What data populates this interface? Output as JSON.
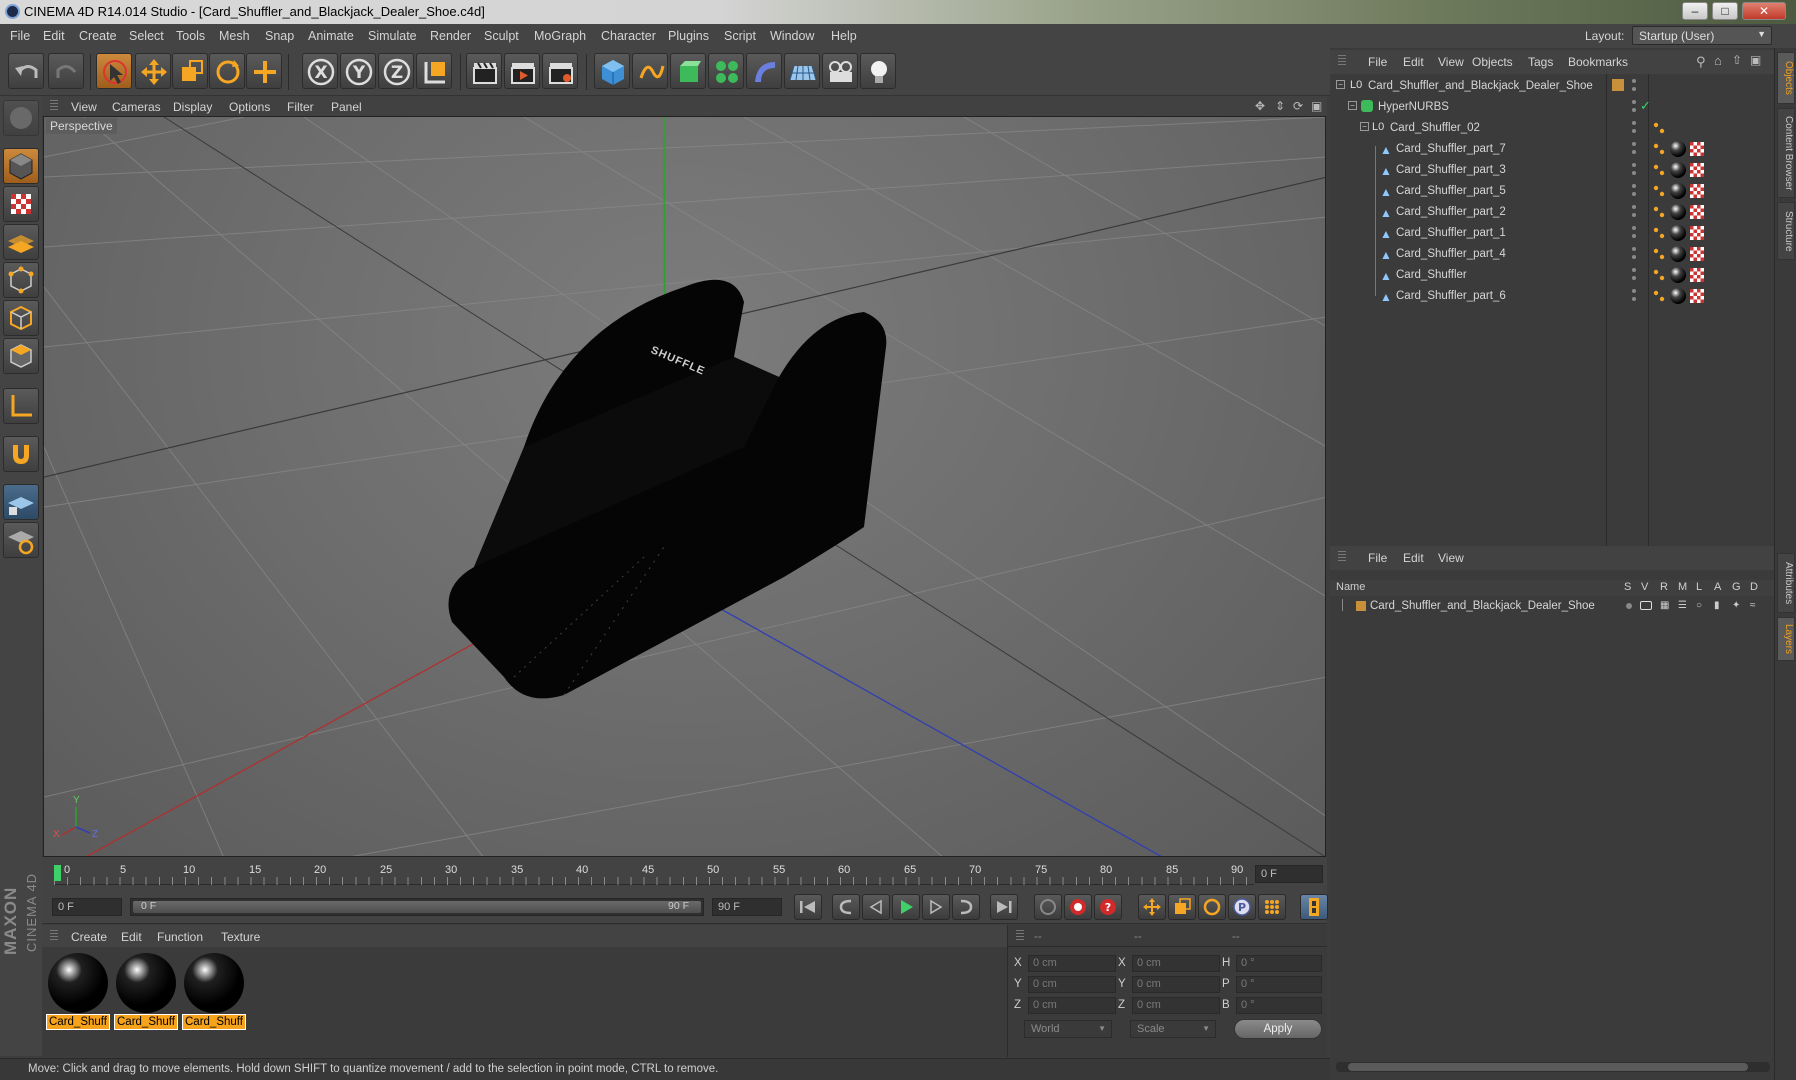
{
  "window": {
    "title": "CINEMA 4D R14.014 Studio - [Card_Shuffler_and_Blackjack_Dealer_Shoe.c4d]"
  },
  "menu": [
    "File",
    "Edit",
    "Create",
    "Select",
    "Tools",
    "Mesh",
    "Snap",
    "Animate",
    "Simulate",
    "Render",
    "Sculpt",
    "MoGraph",
    "Character",
    "Plugins",
    "Script",
    "Window",
    "Help"
  ],
  "layout": {
    "label": "Layout:",
    "value": "Startup (User)"
  },
  "viewport": {
    "menu": [
      "View",
      "Cameras",
      "Display",
      "Options",
      "Filter",
      "Panel"
    ],
    "camera_label": "Perspective",
    "model_text": "SHUFFLE",
    "axis": {
      "x": "X",
      "y": "Y",
      "z": "Z"
    }
  },
  "timeline": {
    "ticks": [
      "0",
      "5",
      "10",
      "15",
      "20",
      "25",
      "30",
      "35",
      "40",
      "45",
      "50",
      "55",
      "60",
      "65",
      "70",
      "75",
      "80",
      "85",
      "90"
    ],
    "current_frame": "0 F"
  },
  "transport": {
    "start_field": "0 F",
    "slider_start": "0 F",
    "slider_end": "90 F",
    "end_field": "90 F"
  },
  "materials": {
    "menu": [
      "Create",
      "Edit",
      "Function",
      "Texture"
    ],
    "items": [
      {
        "label": "Card_Shuff"
      },
      {
        "label": "Card_Shuff"
      },
      {
        "label": "Card_Shuff"
      }
    ]
  },
  "coordinates": {
    "headers": [
      "--",
      "--",
      "--"
    ],
    "rows": [
      {
        "a": "X",
        "av": "0 cm",
        "b": "X",
        "bv": "0 cm",
        "c": "H",
        "cv": "0 °"
      },
      {
        "a": "Y",
        "av": "0 cm",
        "b": "Y",
        "bv": "0 cm",
        "c": "P",
        "cv": "0 °"
      },
      {
        "a": "Z",
        "av": "0 cm",
        "b": "Z",
        "bv": "0 cm",
        "c": "B",
        "cv": "0 °"
      }
    ],
    "mode": "World",
    "type": "Scale",
    "apply": "Apply"
  },
  "status": "Move: Click and drag to move elements. Hold down SHIFT to quantize movement / add to the selection in point mode, CTRL to remove.",
  "objects": {
    "menu": [
      "File",
      "Edit",
      "View",
      "Objects",
      "Tags",
      "Bookmarks"
    ],
    "tree": [
      {
        "name": "Card_Shuffler_and_Blackjack_Dealer_Shoe"
      },
      {
        "name": "HyperNURBS"
      },
      {
        "name": "Card_Shuffler_02"
      },
      {
        "name": "Card_Shuffler_part_7"
      },
      {
        "name": "Card_Shuffler_part_3"
      },
      {
        "name": "Card_Shuffler_part_5"
      },
      {
        "name": "Card_Shuffler_part_2"
      },
      {
        "name": "Card_Shuffler_part_1"
      },
      {
        "name": "Card_Shuffler_part_4"
      },
      {
        "name": "Card_Shuffler"
      },
      {
        "name": "Card_Shuffler_part_6"
      }
    ]
  },
  "layers": {
    "menu": [
      "File",
      "Edit",
      "View"
    ],
    "header_name": "Name",
    "columns": [
      "S",
      "V",
      "R",
      "M",
      "L",
      "A",
      "G",
      "D"
    ],
    "rows": [
      {
        "name": "Card_Shuffler_and_Blackjack_Dealer_Shoe"
      }
    ]
  },
  "side_tabs": [
    "Objects",
    "Content Browser",
    "Structure",
    "Attributes",
    "Layers"
  ],
  "brand": {
    "line1": "MAXON",
    "line2": "CINEMA 4D"
  },
  "colors": {
    "accent_orange": "#f6a21b",
    "panel": "#3b3b3b",
    "axis_x": "#b03030",
    "axis_y": "#2fa02f",
    "axis_z": "#3040b0"
  }
}
